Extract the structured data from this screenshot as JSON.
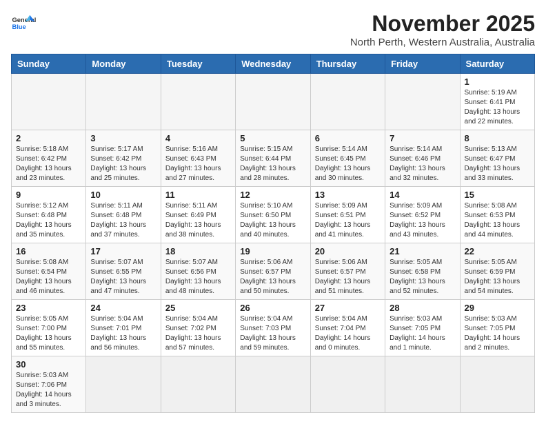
{
  "header": {
    "logo_general": "General",
    "logo_blue": "Blue",
    "month": "November 2025",
    "location": "North Perth, Western Australia, Australia"
  },
  "days_of_week": [
    "Sunday",
    "Monday",
    "Tuesday",
    "Wednesday",
    "Thursday",
    "Friday",
    "Saturday"
  ],
  "weeks": [
    [
      {
        "day": "",
        "info": ""
      },
      {
        "day": "",
        "info": ""
      },
      {
        "day": "",
        "info": ""
      },
      {
        "day": "",
        "info": ""
      },
      {
        "day": "",
        "info": ""
      },
      {
        "day": "",
        "info": ""
      },
      {
        "day": "1",
        "info": "Sunrise: 5:19 AM\nSunset: 6:41 PM\nDaylight: 13 hours\nand 22 minutes."
      }
    ],
    [
      {
        "day": "2",
        "info": "Sunrise: 5:18 AM\nSunset: 6:42 PM\nDaylight: 13 hours\nand 23 minutes."
      },
      {
        "day": "3",
        "info": "Sunrise: 5:17 AM\nSunset: 6:42 PM\nDaylight: 13 hours\nand 25 minutes."
      },
      {
        "day": "4",
        "info": "Sunrise: 5:16 AM\nSunset: 6:43 PM\nDaylight: 13 hours\nand 27 minutes."
      },
      {
        "day": "5",
        "info": "Sunrise: 5:15 AM\nSunset: 6:44 PM\nDaylight: 13 hours\nand 28 minutes."
      },
      {
        "day": "6",
        "info": "Sunrise: 5:14 AM\nSunset: 6:45 PM\nDaylight: 13 hours\nand 30 minutes."
      },
      {
        "day": "7",
        "info": "Sunrise: 5:14 AM\nSunset: 6:46 PM\nDaylight: 13 hours\nand 32 minutes."
      },
      {
        "day": "8",
        "info": "Sunrise: 5:13 AM\nSunset: 6:47 PM\nDaylight: 13 hours\nand 33 minutes."
      }
    ],
    [
      {
        "day": "9",
        "info": "Sunrise: 5:12 AM\nSunset: 6:48 PM\nDaylight: 13 hours\nand 35 minutes."
      },
      {
        "day": "10",
        "info": "Sunrise: 5:11 AM\nSunset: 6:48 PM\nDaylight: 13 hours\nand 37 minutes."
      },
      {
        "day": "11",
        "info": "Sunrise: 5:11 AM\nSunset: 6:49 PM\nDaylight: 13 hours\nand 38 minutes."
      },
      {
        "day": "12",
        "info": "Sunrise: 5:10 AM\nSunset: 6:50 PM\nDaylight: 13 hours\nand 40 minutes."
      },
      {
        "day": "13",
        "info": "Sunrise: 5:09 AM\nSunset: 6:51 PM\nDaylight: 13 hours\nand 41 minutes."
      },
      {
        "day": "14",
        "info": "Sunrise: 5:09 AM\nSunset: 6:52 PM\nDaylight: 13 hours\nand 43 minutes."
      },
      {
        "day": "15",
        "info": "Sunrise: 5:08 AM\nSunset: 6:53 PM\nDaylight: 13 hours\nand 44 minutes."
      }
    ],
    [
      {
        "day": "16",
        "info": "Sunrise: 5:08 AM\nSunset: 6:54 PM\nDaylight: 13 hours\nand 46 minutes."
      },
      {
        "day": "17",
        "info": "Sunrise: 5:07 AM\nSunset: 6:55 PM\nDaylight: 13 hours\nand 47 minutes."
      },
      {
        "day": "18",
        "info": "Sunrise: 5:07 AM\nSunset: 6:56 PM\nDaylight: 13 hours\nand 48 minutes."
      },
      {
        "day": "19",
        "info": "Sunrise: 5:06 AM\nSunset: 6:57 PM\nDaylight: 13 hours\nand 50 minutes."
      },
      {
        "day": "20",
        "info": "Sunrise: 5:06 AM\nSunset: 6:57 PM\nDaylight: 13 hours\nand 51 minutes."
      },
      {
        "day": "21",
        "info": "Sunrise: 5:05 AM\nSunset: 6:58 PM\nDaylight: 13 hours\nand 52 minutes."
      },
      {
        "day": "22",
        "info": "Sunrise: 5:05 AM\nSunset: 6:59 PM\nDaylight: 13 hours\nand 54 minutes."
      }
    ],
    [
      {
        "day": "23",
        "info": "Sunrise: 5:05 AM\nSunset: 7:00 PM\nDaylight: 13 hours\nand 55 minutes."
      },
      {
        "day": "24",
        "info": "Sunrise: 5:04 AM\nSunset: 7:01 PM\nDaylight: 13 hours\nand 56 minutes."
      },
      {
        "day": "25",
        "info": "Sunrise: 5:04 AM\nSunset: 7:02 PM\nDaylight: 13 hours\nand 57 minutes."
      },
      {
        "day": "26",
        "info": "Sunrise: 5:04 AM\nSunset: 7:03 PM\nDaylight: 13 hours\nand 59 minutes."
      },
      {
        "day": "27",
        "info": "Sunrise: 5:04 AM\nSunset: 7:04 PM\nDaylight: 14 hours\nand 0 minutes."
      },
      {
        "day": "28",
        "info": "Sunrise: 5:03 AM\nSunset: 7:05 PM\nDaylight: 14 hours\nand 1 minute."
      },
      {
        "day": "29",
        "info": "Sunrise: 5:03 AM\nSunset: 7:05 PM\nDaylight: 14 hours\nand 2 minutes."
      }
    ],
    [
      {
        "day": "30",
        "info": "Sunrise: 5:03 AM\nSunset: 7:06 PM\nDaylight: 14 hours\nand 3 minutes."
      },
      {
        "day": "",
        "info": ""
      },
      {
        "day": "",
        "info": ""
      },
      {
        "day": "",
        "info": ""
      },
      {
        "day": "",
        "info": ""
      },
      {
        "day": "",
        "info": ""
      },
      {
        "day": "",
        "info": ""
      }
    ]
  ]
}
